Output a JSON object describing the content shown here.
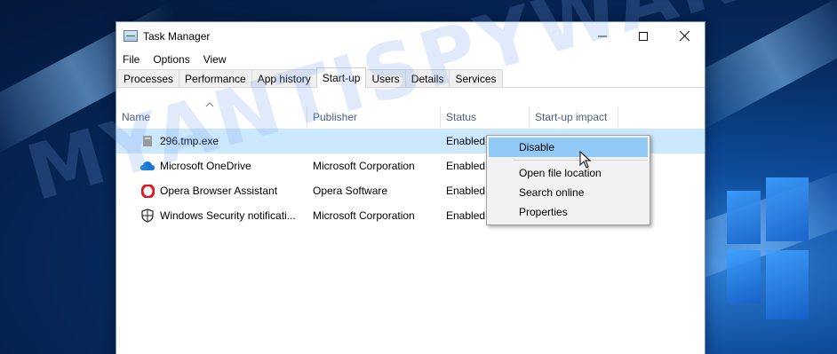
{
  "window": {
    "title": "Task Manager",
    "controls": {
      "minimize": "—",
      "maximize": "☐",
      "close": "✕"
    }
  },
  "menu": [
    "File",
    "Options",
    "View"
  ],
  "tabs": [
    {
      "label": "Processes",
      "active": false
    },
    {
      "label": "Performance",
      "active": false
    },
    {
      "label": "App history",
      "active": false
    },
    {
      "label": "Start-up",
      "active": true
    },
    {
      "label": "Users",
      "active": false
    },
    {
      "label": "Details",
      "active": false
    },
    {
      "label": "Services",
      "active": false
    }
  ],
  "columns": {
    "sort_indicator": "^",
    "name": "Name",
    "publisher": "Publisher",
    "status": "Status",
    "impact": "Start-up impact"
  },
  "rows": [
    {
      "icon": "generic-exe-icon",
      "name": "296.tmp.exe",
      "publisher": "",
      "status": "Enabled",
      "selected": true
    },
    {
      "icon": "onedrive-cloud-icon",
      "name": "Microsoft OneDrive",
      "publisher": "Microsoft Corporation",
      "status": "Enabled",
      "selected": false
    },
    {
      "icon": "opera-icon",
      "name": "Opera Browser Assistant",
      "publisher": "Opera Software",
      "status": "Enabled",
      "selected": false
    },
    {
      "icon": "windows-security-shield-icon",
      "name": "Windows Security notificati...",
      "publisher": "Microsoft Corporation",
      "status": "Enabled",
      "selected": false
    }
  ],
  "context_menu": {
    "items": [
      "Disable",
      "Open file location",
      "Search online",
      "Properties"
    ],
    "hovered": "Disable"
  },
  "watermark": "MYANTISPYWARE.COM",
  "colors": {
    "selection": "#cce8ff",
    "menu_hover": "#91c9f7",
    "desktop": "#0d4b9a",
    "opera_red": "#e0191f",
    "onedrive_blue": "#1677d6"
  }
}
